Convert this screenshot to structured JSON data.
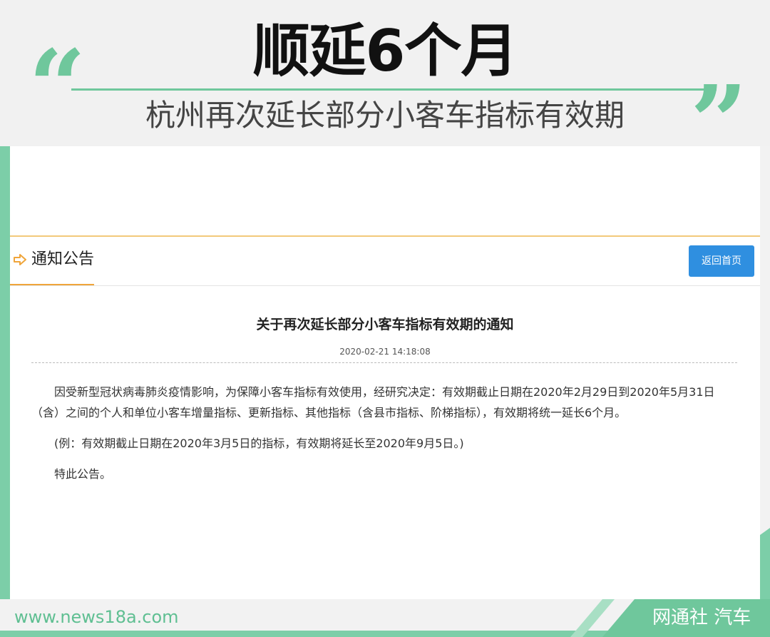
{
  "banner": {
    "headline": "顺延6个月",
    "subheadline": "杭州再次延长部分小客车指标有效期",
    "quote_open": "“",
    "quote_close": "”"
  },
  "section": {
    "title": "通知公告",
    "arrow_icon": "arrow-right-icon",
    "home_button_label": "返回首页"
  },
  "notice": {
    "title": "关于再次延长部分小客车指标有效期的通知",
    "date": "2020-02-21 14:18:08",
    "paragraphs": [
      "因受新型冠状病毒肺炎疫情影响，为保障小客车指标有效使用，经研究决定：有效期截止日期在2020年2月29日到2020年5月31日（含）之间的个人和单位小客车增量指标、更新指标、其他指标（含县市指标、阶梯指标），有效期将统一延长6个月。",
      "(例：有效期截止日期在2020年3月5日的指标，有效期将延长至2020年9月5日。)",
      "特此公告。"
    ]
  },
  "footer": {
    "url": "www.news18a.com",
    "brand": "网通社 汽车"
  },
  "colors": {
    "accent_green": "#6fc79c",
    "accent_orange": "#f0a53a",
    "button_blue": "#2f8fe0"
  }
}
